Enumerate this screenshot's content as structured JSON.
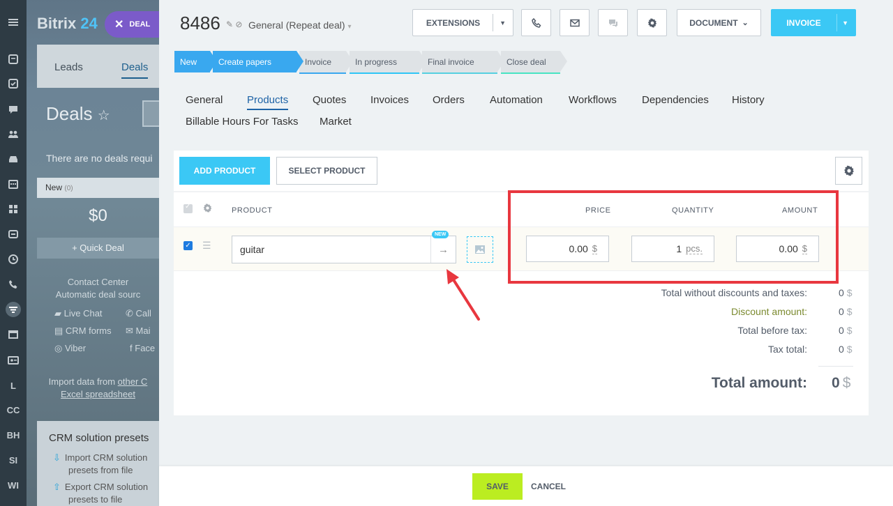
{
  "rail": {
    "icons": [
      "menu-icon",
      "feed-icon",
      "tasks-icon",
      "chat-icon",
      "groups-icon",
      "drive-icon",
      "calendar-icon",
      "apps-icon",
      "sync-icon",
      "clock-icon",
      "phone-icon",
      "filter-icon",
      "window-icon",
      "contact-card-icon"
    ],
    "text_items": [
      "L",
      "CC",
      "BH",
      "SI",
      "WI"
    ]
  },
  "background": {
    "logo": "Bitrix",
    "logo_num": "24",
    "deal_chip": "DEAL",
    "tabs": [
      "Leads",
      "Deals"
    ],
    "title": "Deals",
    "notice": "There are no deals requi",
    "column_name": "New",
    "column_count": "(0)",
    "column_amount": "$0",
    "quick_deal": "+ Quick Deal",
    "contact_center": "Contact Center",
    "automatic_sources": "Automatic deal sourc",
    "sources": [
      "Live Chat",
      "Call",
      "CRM forms",
      "Mai",
      "Viber",
      "Face"
    ],
    "import_text": "Import data from",
    "import_link1": "other C",
    "import_link2": "Excel spreadsheet",
    "presets_title": "CRM solution presets",
    "preset_items": [
      {
        "line1": "Import CRM solution",
        "line2": "presets from file"
      },
      {
        "line1": "Export CRM solution",
        "line2": "presets to file"
      }
    ]
  },
  "header": {
    "deal_id": "8486",
    "category": "General (Repeat deal)"
  },
  "toolbar": {
    "extensions": "EXTENSIONS",
    "document": "DOCUMENT",
    "invoice": "INVOICE"
  },
  "pipeline": {
    "stages": [
      "New",
      "Create papers",
      "Invoice",
      "In progress",
      "Final invoice",
      "Close deal"
    ],
    "current_index": 1
  },
  "tabs": [
    "General",
    "Products",
    "Quotes",
    "Invoices",
    "Orders",
    "Automation",
    "Workflows",
    "Dependencies",
    "History",
    "Billable Hours For Tasks",
    "Market"
  ],
  "active_tab": "Products",
  "products": {
    "add_button": "ADD PRODUCT",
    "select_button": "SELECT PRODUCT",
    "columns": {
      "product": "PRODUCT",
      "price": "PRICE",
      "quantity": "QUANTITY",
      "amount": "AMOUNT"
    },
    "rows": [
      {
        "name": "guitar",
        "badge": "NEW",
        "price": "0.00",
        "currency": "$",
        "quantity": "1",
        "unit": "pcs.",
        "amount": "0.00"
      }
    ],
    "totals": {
      "without_discounts_label": "Total without discounts and taxes:",
      "without_discounts_value": "0",
      "discount_label": "Discount amount:",
      "discount_value": "0",
      "before_tax_label": "Total before tax:",
      "before_tax_value": "0",
      "tax_label": "Tax total:",
      "tax_value": "0",
      "grand_label": "Total amount:",
      "grand_value": "0",
      "currency": "$"
    }
  },
  "footer": {
    "save": "SAVE",
    "cancel": "CANCEL"
  },
  "colors": {
    "accent": "#3bc8f5",
    "stage_active": "#39a8ef",
    "save": "#bbed21",
    "highlight": "#e8373f"
  }
}
